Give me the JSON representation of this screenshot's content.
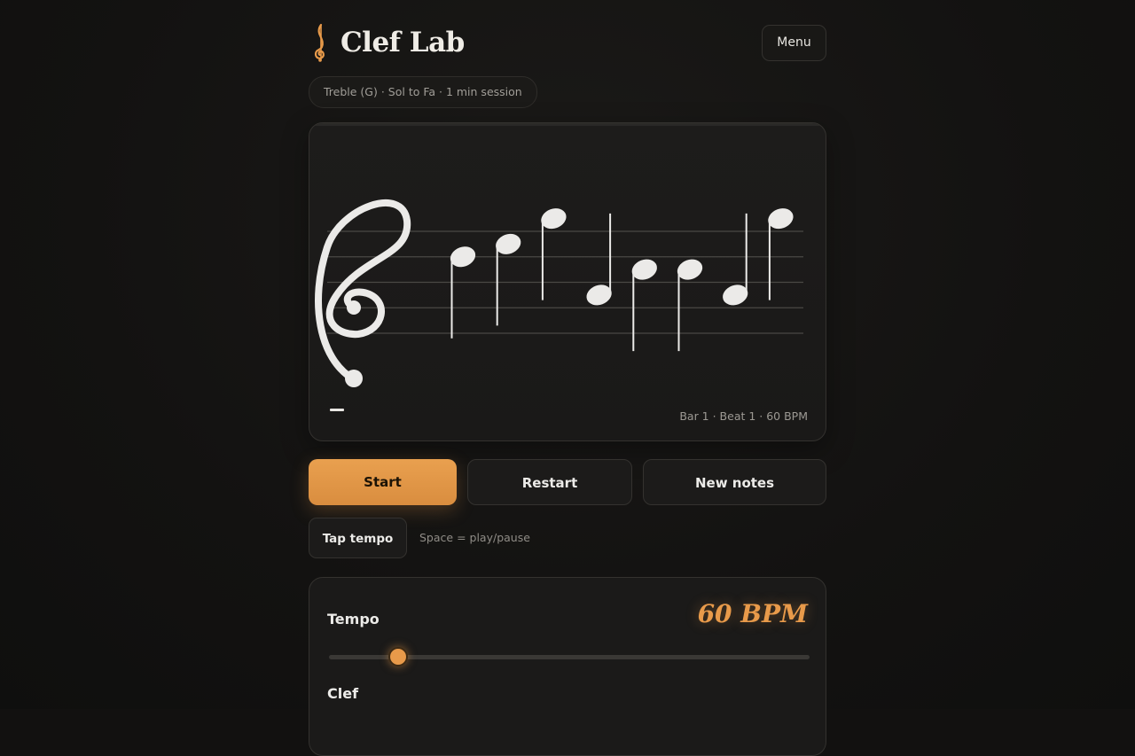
{
  "app": {
    "title": "Clef Lab",
    "menu_label": "Menu"
  },
  "session_chip": "Treble (G) · Sol to Fa · 1 min session",
  "staff": {
    "clef": "treble",
    "status": "Bar 1 · Beat 1 · 60 BPM",
    "notes": [
      "D5",
      "E5",
      "G5",
      "A4",
      "C5",
      "C5",
      "A4",
      "G5"
    ]
  },
  "controls": {
    "start_label": "Start",
    "restart_label": "Restart",
    "new_notes_label": "New notes",
    "tap_tempo_label": "Tap tempo",
    "shortcut_hint": "Space = play/pause"
  },
  "settings": {
    "tempo_label": "Tempo",
    "tempo_value": "60 BPM",
    "tempo_slider_fraction": 0.14,
    "clef_label": "Clef"
  },
  "colors": {
    "accent": "#e89a4a",
    "background": "#121110",
    "card": "#1b1a19",
    "note": "#ebeae8"
  },
  "icons": {
    "logo": "treble-clef-icon"
  }
}
